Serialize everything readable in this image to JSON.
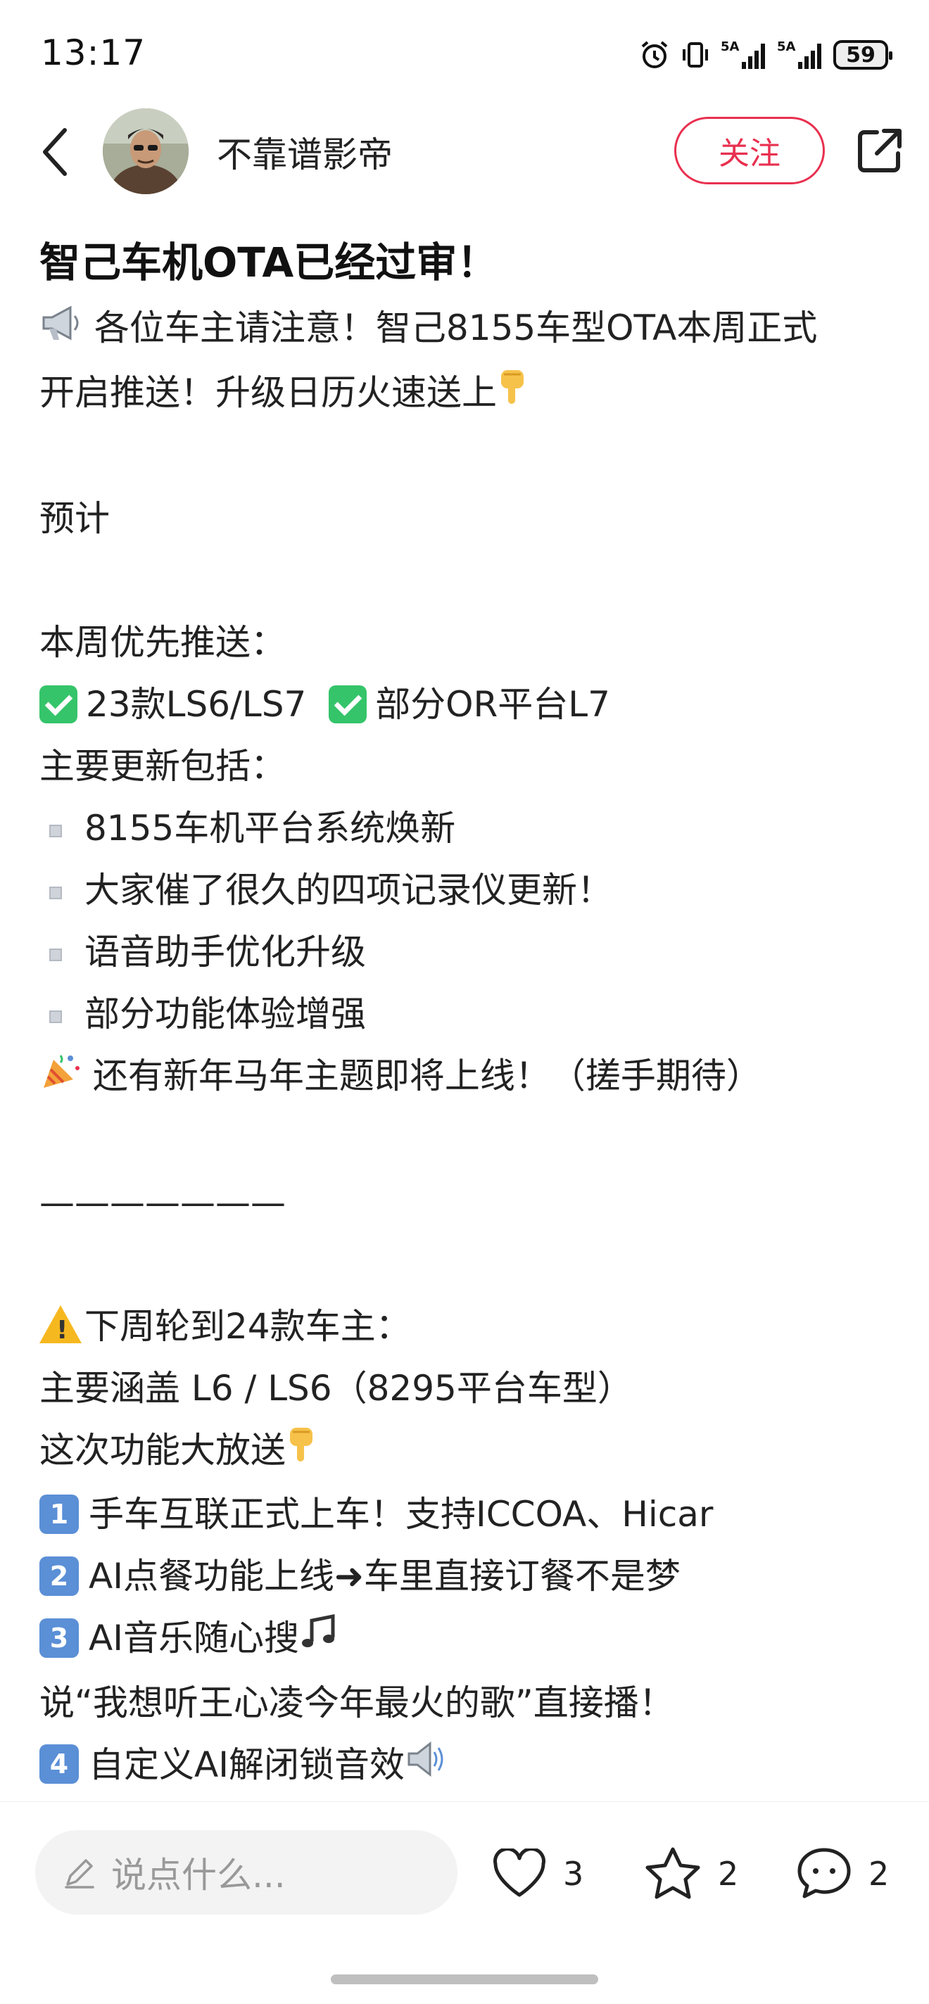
{
  "status_bar": {
    "time": "13:17",
    "battery": "59",
    "network_labels": [
      "5A",
      "5A"
    ]
  },
  "header": {
    "author_name": "不靠谱影帝",
    "follow_label": "关注"
  },
  "post": {
    "title": "智己车机OTA已经过审！",
    "intro_line1": " 各位车主请注意！智己8155车型OTA本周正式",
    "intro_line2": "开启推送！升级日历火速送上",
    "predict": "预计",
    "priority_heading": "本周优先推送：",
    "priority_item1": "23款LS6/LS7",
    "priority_item2": "部分OR平台L7",
    "updates_heading": "主要更新包括：",
    "update_items": [
      "8155车机平台系统焕新",
      "大家催了很久的四项记录仪更新！",
      "语音助手优化升级",
      "部分功能体验增强"
    ],
    "new_year_line": " 还有新年马年主题即将上线！（搓手期待）",
    "divider": "———————",
    "next_week_heading": "下周轮到24款车主：",
    "models_line": "主要涵盖 L6 / LS6（8295平台车型）",
    "features_heading": "这次功能大放送",
    "feature_items": [
      {
        "num": "1",
        "text": "手车互联正式上车！支持ICCOA、Hicar"
      },
      {
        "num": "2",
        "text": "AI点餐功能上线➜车里直接订餐不是梦"
      },
      {
        "num": "3",
        "text": "AI音乐随心搜"
      }
    ],
    "music_quote": "说“我想听王心凌今年最火的歌”直接播！",
    "feature_item4": {
      "num": "4",
      "text": "自定义AI解闭锁音效"
    }
  },
  "bottom_bar": {
    "comment_placeholder": "说点什么...",
    "like_count": "3",
    "collect_count": "2",
    "comment_count": "2"
  },
  "colors": {
    "accent_red": "#e8304f",
    "check_green": "#35c46a",
    "number_blue": "#5b8fd6",
    "warning_yellow": "#f6b81f"
  },
  "icons": [
    "alarm-icon",
    "vibrate-icon",
    "signal-icon",
    "battery-icon",
    "back-icon",
    "share-icon",
    "megaphone-icon",
    "pointing-down-icon",
    "check-icon",
    "bullet-icon",
    "party-icon",
    "warning-icon",
    "arrow-right-icon",
    "music-note-icon",
    "speaker-icon",
    "pencil-icon",
    "heart-icon",
    "star-icon",
    "comment-icon"
  ]
}
